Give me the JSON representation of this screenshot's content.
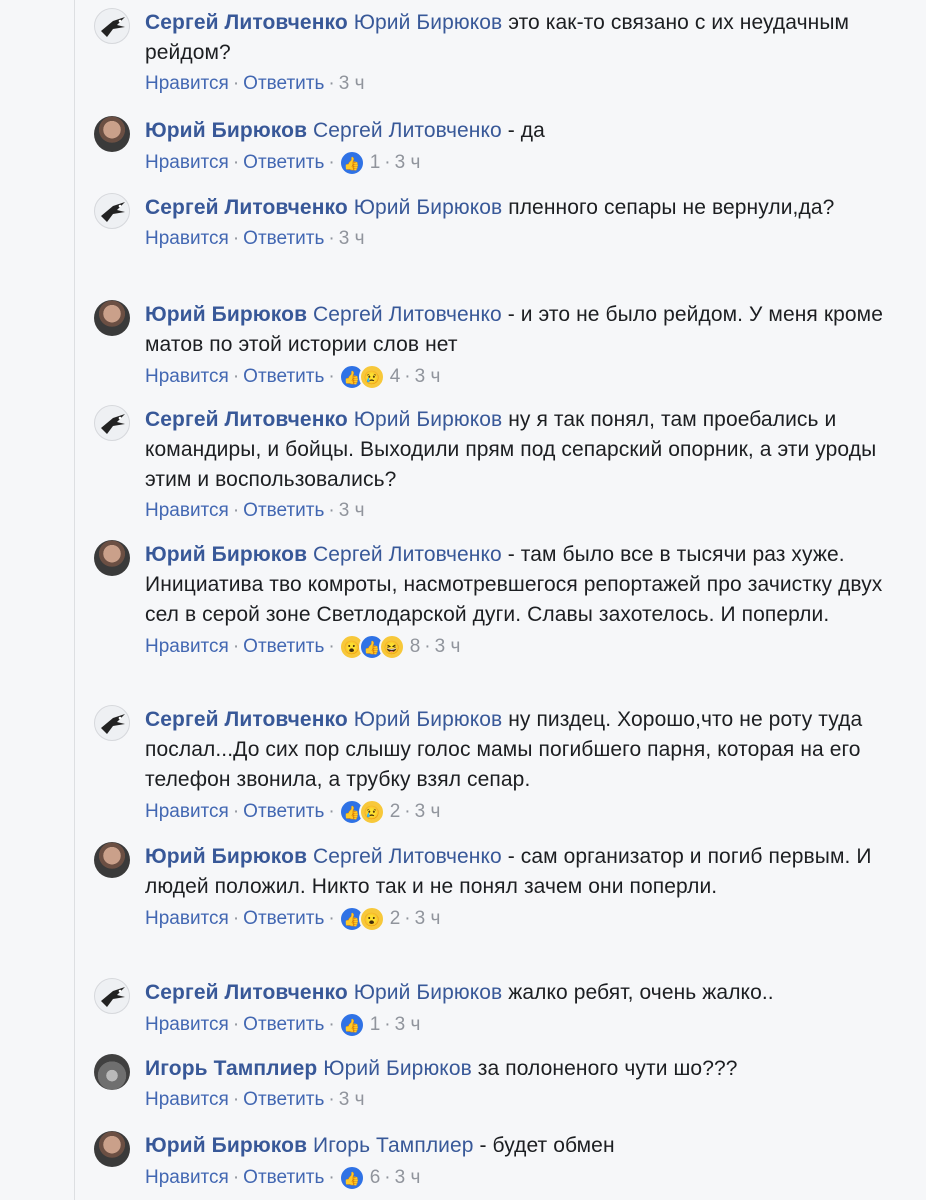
{
  "labels": {
    "like": "Нравится",
    "reply": "Ответить",
    "sep": "·"
  },
  "comments": [
    {
      "author": "Сергей Литовченко",
      "mention": "Юрий Бирюков",
      "dash": "",
      "text": "это как-то связано с их неудачным рейдом?",
      "reaction_count": "",
      "time": "3 ч",
      "avatar": "bird-avatar"
    },
    {
      "author": "Юрий Бирюков",
      "mention": "Сергей Литовченко",
      "dash": "-",
      "text": "да",
      "reaction_count": "1",
      "time": "3 ч",
      "avatar": "photo-avatar"
    },
    {
      "author": "Сергей Литовченко",
      "mention": "Юрий Бирюков",
      "dash": "",
      "text": "пленного сепары не вернули,да?",
      "reaction_count": "",
      "time": "3 ч",
      "avatar": "bird-avatar"
    },
    {
      "author": "Юрий Бирюков",
      "mention": "Сергей Литовченко",
      "dash": "-",
      "text": "и это не было рейдом. У меня кроме матов по этой истории слов нет",
      "reaction_count": "4",
      "time": "3 ч",
      "avatar": "photo-avatar"
    },
    {
      "author": "Сергей Литовченко",
      "mention": "Юрий Бирюков",
      "dash": "",
      "text": "ну я так понял, там проебались и командиры, и бойцы. Выходили прям под сепарский опорник, а эти уроды этим и воспользовались?",
      "reaction_count": "",
      "time": "3 ч",
      "avatar": "bird-avatar"
    },
    {
      "author": "Юрий Бирюков",
      "mention": "Сергей Литовченко",
      "dash": "-",
      "text": "там было все в тысячи раз хуже. Инициатива тво комроты, насмотревшегося репортажей про зачистку двух сел в серой зоне Светлодарской дуги. Славы захотелось. И поперли.",
      "reaction_count": "8",
      "time": "3 ч",
      "avatar": "photo-avatar"
    },
    {
      "author": "Сергей Литовченко",
      "mention": "Юрий Бирюков",
      "dash": "",
      "text": "ну пиздец. Хорошо,что не роту туда послал...До сих пор слышу голос мамы погибшего парня, которая на его телефон звонила, а трубку взял сепар.",
      "reaction_count": "2",
      "time": "3 ч",
      "avatar": "bird-avatar"
    },
    {
      "author": "Юрий Бирюков",
      "mention": "Сергей Литовченко",
      "dash": "-",
      "text": "сам организатор и погиб первым. И людей положил. Никто так и не понял зачем они поперли.",
      "reaction_count": "2",
      "time": "3 ч",
      "avatar": "photo-avatar"
    },
    {
      "author": "Сергей Литовченко",
      "mention": "Юрий Бирюков",
      "dash": "",
      "text": "жалко ребят, очень жалко..",
      "reaction_count": "1",
      "time": "3 ч",
      "avatar": "bird-avatar"
    },
    {
      "author": "Игорь Тамплиер",
      "mention": "Юрий Бирюков",
      "dash": "",
      "text": "за полоненого чути шо???",
      "reaction_count": "",
      "time": "3 ч",
      "avatar": "photo-avatar"
    },
    {
      "author": "Юрий Бирюков",
      "mention": "Игорь Тамплиер",
      "dash": "-",
      "text": "будет обмен",
      "reaction_count": "6",
      "time": "3 ч",
      "avatar": "photo-avatar"
    }
  ]
}
